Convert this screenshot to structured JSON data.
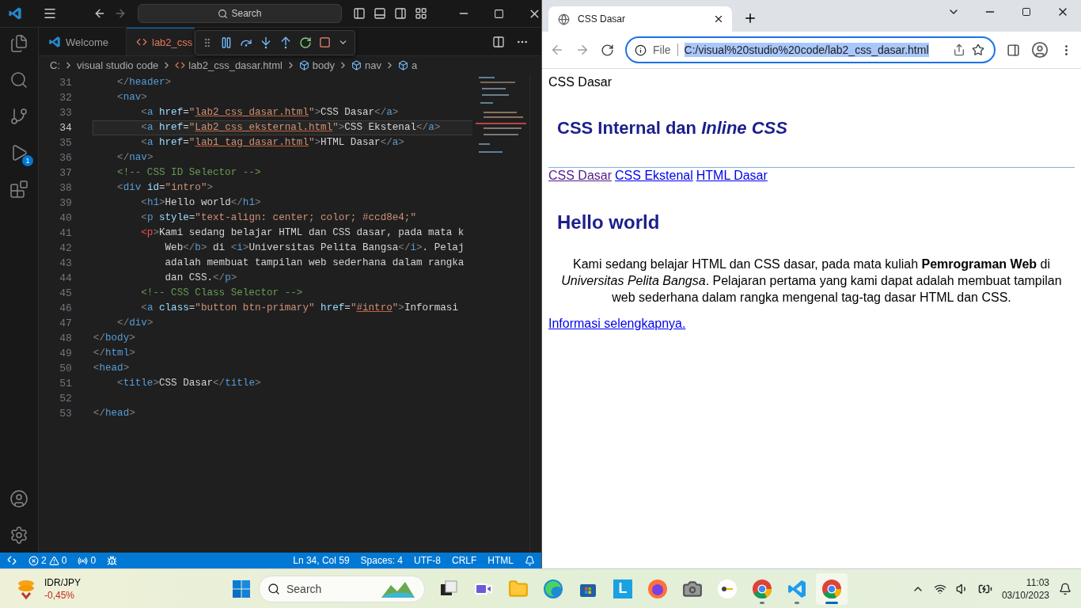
{
  "vscode": {
    "title_search": "Search",
    "activity": [
      {
        "kind": "explorer"
      },
      {
        "kind": "search"
      },
      {
        "kind": "scm"
      },
      {
        "kind": "debug",
        "badge": "1"
      },
      {
        "kind": "extensions"
      }
    ],
    "tabs": [
      {
        "label": "Welcome",
        "kind": "welcome",
        "selected": false
      },
      {
        "label": "lab2_css",
        "kind": "html",
        "selected": true
      }
    ],
    "breadcrumb": [
      {
        "label": "C:",
        "kind": "drive"
      },
      {
        "label": "visual studio code",
        "kind": "folder"
      },
      {
        "label": "lab2_css_dasar.html",
        "kind": "file"
      },
      {
        "label": "body",
        "kind": "symbol"
      },
      {
        "label": "nav",
        "kind": "symbol"
      },
      {
        "label": "a",
        "kind": "symbol"
      }
    ],
    "lines": [
      {
        "number": "31",
        "selected": false,
        "tokens": [
          {
            "kind": "p",
            "text": "    </"
          },
          {
            "kind": "tag",
            "text": "header"
          },
          {
            "kind": "p",
            "text": ">"
          }
        ]
      },
      {
        "number": "32",
        "selected": false,
        "tokens": [
          {
            "kind": "p",
            "text": "    <"
          },
          {
            "kind": "tag",
            "text": "nav"
          },
          {
            "kind": "p",
            "text": ">"
          }
        ]
      },
      {
        "number": "33",
        "selected": false,
        "tokens": [
          {
            "kind": "p",
            "text": "        <"
          },
          {
            "kind": "tag",
            "text": "a"
          },
          {
            "kind": "attr",
            "text": " href"
          },
          {
            "kind": "t",
            "text": "="
          },
          {
            "kind": "str",
            "text": "\""
          },
          {
            "kind": "link",
            "text": "lab2_css_dasar.html"
          },
          {
            "kind": "str",
            "text": "\""
          },
          {
            "kind": "p",
            "text": ">"
          },
          {
            "kind": "t",
            "text": "CSS Dasar"
          },
          {
            "kind": "p",
            "text": "</"
          },
          {
            "kind": "tag",
            "text": "a"
          },
          {
            "kind": "p",
            "text": ">"
          }
        ]
      },
      {
        "number": "34",
        "selected": true,
        "tokens": [
          {
            "kind": "p",
            "text": "        <"
          },
          {
            "kind": "tag",
            "text": "a"
          },
          {
            "kind": "attr",
            "text": " href"
          },
          {
            "kind": "t",
            "text": "="
          },
          {
            "kind": "str",
            "text": "\""
          },
          {
            "kind": "link",
            "text": "Lab2_css_eksternal.html"
          },
          {
            "kind": "str",
            "text": "\""
          },
          {
            "kind": "p",
            "text": ">"
          },
          {
            "kind": "t",
            "text": "CSS Ekstenal"
          },
          {
            "kind": "p",
            "text": "</"
          },
          {
            "kind": "tag",
            "text": "a"
          },
          {
            "kind": "p",
            "text": ">"
          }
        ]
      },
      {
        "number": "35",
        "selected": false,
        "tokens": [
          {
            "kind": "p",
            "text": "        <"
          },
          {
            "kind": "tag",
            "text": "a"
          },
          {
            "kind": "attr",
            "text": " href"
          },
          {
            "kind": "t",
            "text": "="
          },
          {
            "kind": "str",
            "text": "\""
          },
          {
            "kind": "link",
            "text": "lab1_tag_dasar.html"
          },
          {
            "kind": "str",
            "text": "\""
          },
          {
            "kind": "p",
            "text": ">"
          },
          {
            "kind": "t",
            "text": "HTML Dasar"
          },
          {
            "kind": "p",
            "text": "</"
          },
          {
            "kind": "tag",
            "text": "a"
          },
          {
            "kind": "p",
            "text": ">"
          }
        ]
      },
      {
        "number": "36",
        "selected": false,
        "tokens": [
          {
            "kind": "p",
            "text": "    </"
          },
          {
            "kind": "tag",
            "text": "nav"
          },
          {
            "kind": "p",
            "text": ">"
          }
        ]
      },
      {
        "number": "37",
        "selected": false,
        "tokens": [
          {
            "kind": "c",
            "text": "    <!-- CSS ID Selector -->"
          }
        ]
      },
      {
        "number": "38",
        "selected": false,
        "tokens": [
          {
            "kind": "p",
            "text": "    <"
          },
          {
            "kind": "tag",
            "text": "div"
          },
          {
            "kind": "attr",
            "text": " id"
          },
          {
            "kind": "t",
            "text": "="
          },
          {
            "kind": "str",
            "text": "\"intro\""
          },
          {
            "kind": "p",
            "text": ">"
          }
        ]
      },
      {
        "number": "39",
        "selected": false,
        "tokens": [
          {
            "kind": "p",
            "text": "        <"
          },
          {
            "kind": "tag",
            "text": "h1"
          },
          {
            "kind": "p",
            "text": ">"
          },
          {
            "kind": "t",
            "text": "Hello world"
          },
          {
            "kind": "p",
            "text": "</"
          },
          {
            "kind": "tag",
            "text": "h1"
          },
          {
            "kind": "p",
            "text": ">"
          }
        ]
      },
      {
        "number": "40",
        "selected": false,
        "tokens": [
          {
            "kind": "p",
            "text": "        <"
          },
          {
            "kind": "tag",
            "text": "p"
          },
          {
            "kind": "attr",
            "text": " style"
          },
          {
            "kind": "t",
            "text": "="
          },
          {
            "kind": "str",
            "text": "\"text-align: center; color; #ccd8e4;\""
          }
        ]
      },
      {
        "number": "41",
        "selected": false,
        "tokens": [
          {
            "kind": "err",
            "text": "        <p"
          },
          {
            "kind": "p",
            "text": ">"
          },
          {
            "kind": "t",
            "text": "Kami sedang belajar HTML dan CSS dasar, pada mata k"
          }
        ]
      },
      {
        "number": "42",
        "selected": false,
        "tokens": [
          {
            "kind": "t",
            "text": "            Web"
          },
          {
            "kind": "p",
            "text": "</"
          },
          {
            "kind": "tag",
            "text": "b"
          },
          {
            "kind": "p",
            "text": ">"
          },
          {
            "kind": "t",
            "text": " di "
          },
          {
            "kind": "p",
            "text": "<"
          },
          {
            "kind": "tag",
            "text": "i"
          },
          {
            "kind": "p",
            "text": ">"
          },
          {
            "kind": "t",
            "text": "Universitas Pelita Bangsa"
          },
          {
            "kind": "p",
            "text": "</"
          },
          {
            "kind": "tag",
            "text": "i"
          },
          {
            "kind": "p",
            "text": ">"
          },
          {
            "kind": "t",
            "text": ". Pelaj"
          }
        ]
      },
      {
        "number": "43",
        "selected": false,
        "tokens": [
          {
            "kind": "t",
            "text": "            adalah membuat tampilan web sederhana dalam rangka"
          }
        ]
      },
      {
        "number": "44",
        "selected": false,
        "tokens": [
          {
            "kind": "t",
            "text": "            dan CSS."
          },
          {
            "kind": "p",
            "text": "</"
          },
          {
            "kind": "tag",
            "text": "p"
          },
          {
            "kind": "p",
            "text": ">"
          }
        ]
      },
      {
        "number": "45",
        "selected": false,
        "tokens": [
          {
            "kind": "c",
            "text": "        <!-- CSS Class Selector -->"
          }
        ]
      },
      {
        "number": "46",
        "selected": false,
        "tokens": [
          {
            "kind": "p",
            "text": "        <"
          },
          {
            "kind": "tag",
            "text": "a"
          },
          {
            "kind": "attr",
            "text": " class"
          },
          {
            "kind": "t",
            "text": "="
          },
          {
            "kind": "str",
            "text": "\"button btn-primary\""
          },
          {
            "kind": "attr",
            "text": " href"
          },
          {
            "kind": "t",
            "text": "="
          },
          {
            "kind": "str",
            "text": "\""
          },
          {
            "kind": "link",
            "text": "#intro"
          },
          {
            "kind": "str",
            "text": "\""
          },
          {
            "kind": "p",
            "text": ">"
          },
          {
            "kind": "t",
            "text": "Informasi"
          }
        ]
      },
      {
        "number": "47",
        "selected": false,
        "tokens": [
          {
            "kind": "p",
            "text": "    </"
          },
          {
            "kind": "tag",
            "text": "div"
          },
          {
            "kind": "p",
            "text": ">"
          }
        ]
      },
      {
        "number": "48",
        "selected": false,
        "tokens": [
          {
            "kind": "p",
            "text": "</"
          },
          {
            "kind": "tag",
            "text": "body"
          },
          {
            "kind": "p",
            "text": ">"
          }
        ]
      },
      {
        "number": "49",
        "selected": false,
        "tokens": [
          {
            "kind": "p",
            "text": "</"
          },
          {
            "kind": "tag",
            "text": "html"
          },
          {
            "kind": "p",
            "text": ">"
          }
        ]
      },
      {
        "number": "50",
        "selected": false,
        "tokens": [
          {
            "kind": "p",
            "text": "<"
          },
          {
            "kind": "tag",
            "text": "head"
          },
          {
            "kind": "p",
            "text": ">"
          }
        ]
      },
      {
        "number": "51",
        "selected": false,
        "tokens": [
          {
            "kind": "p",
            "text": "    <"
          },
          {
            "kind": "tag",
            "text": "title"
          },
          {
            "kind": "p",
            "text": ">"
          },
          {
            "kind": "t",
            "text": "CSS Dasar"
          },
          {
            "kind": "p",
            "text": "</"
          },
          {
            "kind": "tag",
            "text": "title"
          },
          {
            "kind": "p",
            "text": ">"
          }
        ]
      },
      {
        "number": "52",
        "selected": false
      },
      {
        "number": "53",
        "selected": false,
        "tokens": [
          {
            "kind": "p",
            "text": "</"
          },
          {
            "kind": "tag",
            "text": "head"
          },
          {
            "kind": "p",
            "text": ">"
          }
        ]
      }
    ],
    "status": {
      "errors": "2",
      "warnings": "0",
      "ports": "0",
      "position": "Ln 34, Col 59",
      "spaces": "Spaces: 4",
      "encoding": "UTF-8",
      "eol": "CRLF",
      "language": "HTML"
    }
  },
  "browser": {
    "tab": {
      "title": "CSS Dasar",
      "selected": true
    },
    "address": {
      "scheme": "File",
      "url": "C:/visual%20studio%20code/lab2_css_dasar.html",
      "selected": true
    },
    "page": {
      "header": "CSS Dasar",
      "title": "CSS Internal dan *Inline CSS*",
      "nav": [
        {
          "label": "CSS Dasar",
          "visited": true
        },
        {
          "label": "CSS Ekstenal",
          "visited": false
        },
        {
          "label": "HTML Dasar",
          "visited": false
        }
      ],
      "heading": "Hello world",
      "paragraph": "Kami sedang belajar HTML dan CSS dasar, pada mata kuliah **Pemrograman Web** di *Universitas Pelita Bangsa*. Pelajaran pertama yang kami dapat adalah membuat tampilan web sederhana dalam rangka mengenal tag-tag dasar HTML dan CSS.",
      "link": "Informasi selengkapnya."
    }
  },
  "taskbar": {
    "widget": {
      "title": "IDR/JPY",
      "change": "-0,45%"
    },
    "search": "Search",
    "apps": [
      {
        "kind": "taskview",
        "running": false,
        "selected": false
      },
      {
        "kind": "chat",
        "running": false,
        "selected": false
      },
      {
        "kind": "files",
        "running": false,
        "selected": false
      },
      {
        "kind": "edge",
        "running": false,
        "selected": false
      },
      {
        "kind": "store",
        "running": false,
        "selected": false
      },
      {
        "kind": "launcher",
        "label": "L",
        "running": false,
        "selected": false
      },
      {
        "kind": "firefox",
        "running": false,
        "selected": false
      },
      {
        "kind": "camera",
        "running": false,
        "selected": false
      },
      {
        "kind": "keys",
        "running": false,
        "selected": false
      },
      {
        "kind": "chrome",
        "running": true,
        "selected": false
      },
      {
        "kind": "vscode",
        "running": true,
        "selected": false
      },
      {
        "kind": "chrome",
        "running": true,
        "selected": true
      }
    ],
    "time": "11:03",
    "date": "03/10/2023"
  }
}
